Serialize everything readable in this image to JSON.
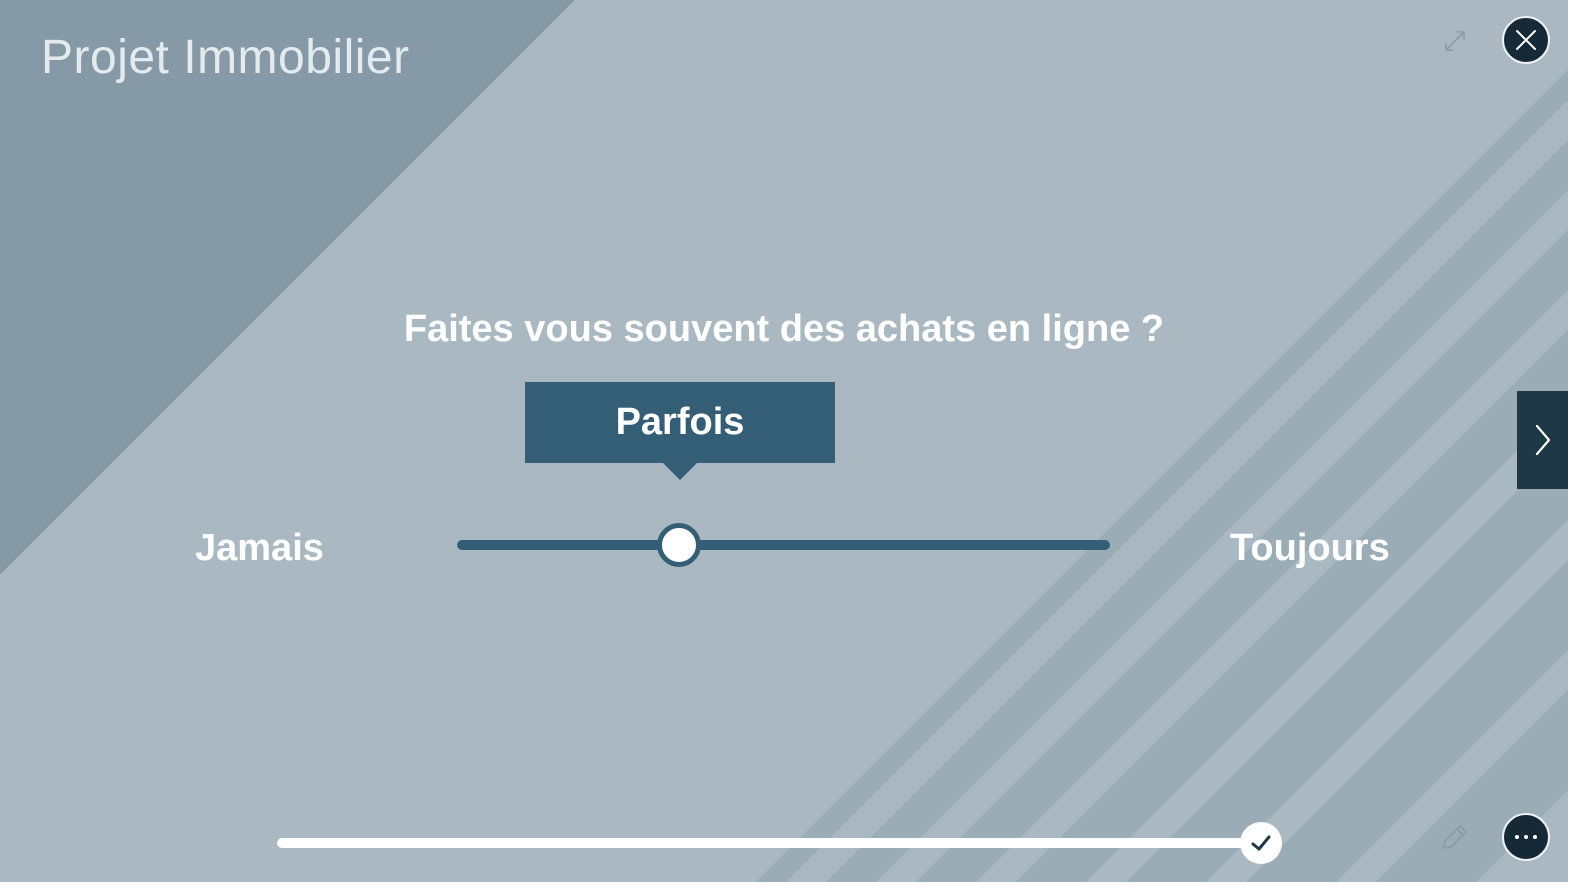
{
  "app": {
    "title": "Projet Immobilier"
  },
  "question": {
    "text": "Faites vous souvent des achats en ligne ?"
  },
  "rating": {
    "selected_label": "Parfois",
    "min_label": "Jamais",
    "max_label": "Toujours",
    "value_fraction": 0.34
  },
  "progress": {
    "fraction": 0.98
  },
  "icons": {
    "expand": "expand-icon",
    "close": "close-icon",
    "next": "chevron-right-icon",
    "check": "check-icon",
    "edit": "pencil-icon",
    "more": "more-icon"
  },
  "colors": {
    "background": "#aab9c1",
    "accent": "#345e76",
    "dark_button": "#152a36",
    "text": "#ffffff"
  }
}
